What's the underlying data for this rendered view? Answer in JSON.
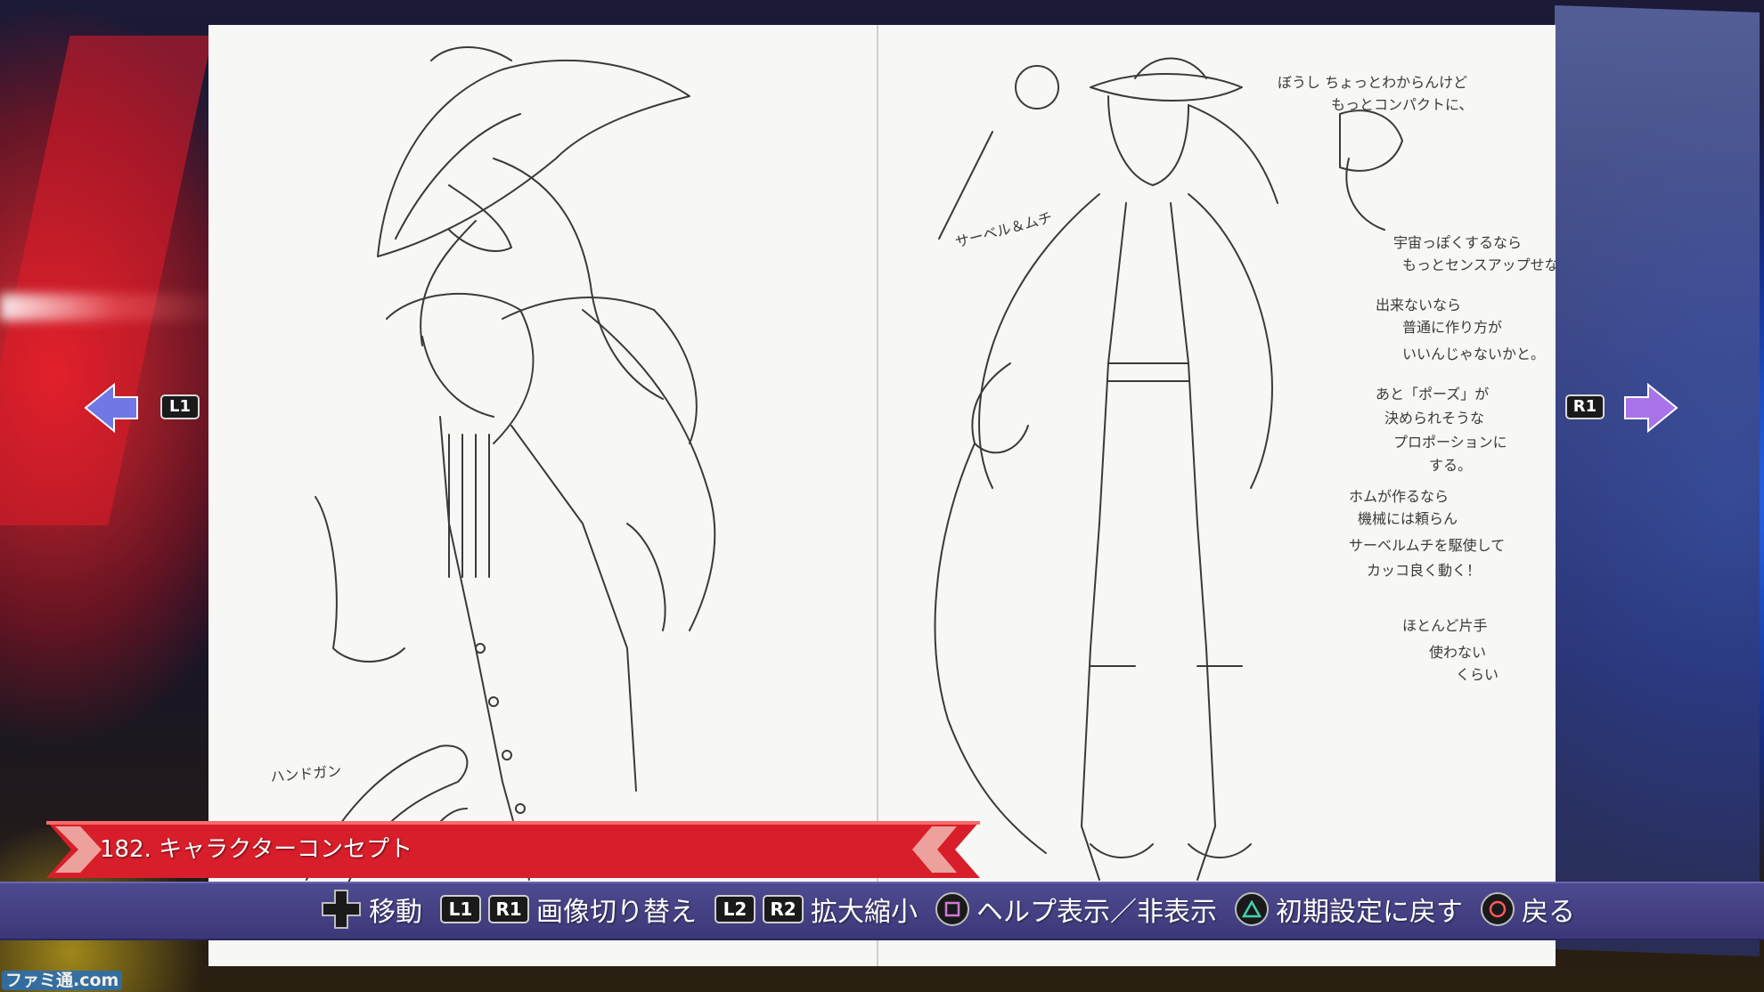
{
  "gallery": {
    "title": "182. キャラクターコンセプト",
    "prev_button": "L1",
    "next_button": "R1"
  },
  "controls": {
    "move_label": "移動",
    "l1": "L1",
    "r1": "R1",
    "switch_label": "画像切り替え",
    "l2": "L2",
    "r2": "R2",
    "zoom_label": "拡大縮小",
    "help_label": "ヘルプ表示／非表示",
    "reset_label": "初期設定に戻す",
    "back_label": "戻る"
  },
  "colors": {
    "banner_red": "#d81e2a",
    "bar_purple": "#45418a",
    "arrow_blue": "#6f78e6",
    "arrow_purple": "#a873e8"
  },
  "watermark": "ファミ通.com"
}
